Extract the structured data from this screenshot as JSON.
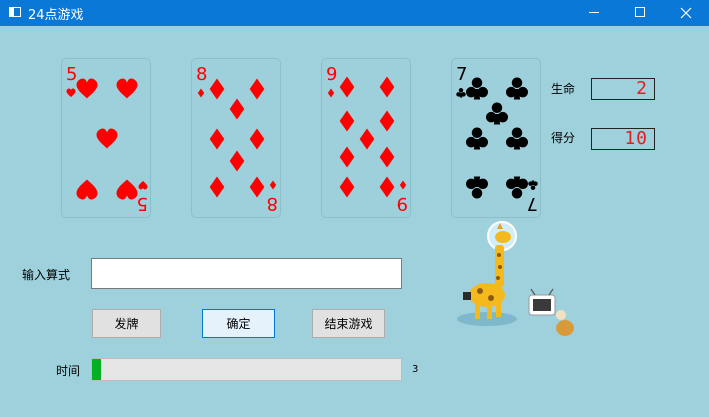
{
  "window": {
    "title": "24点游戏",
    "controls": [
      "minimize-icon",
      "maximize-icon",
      "close-icon"
    ]
  },
  "cards": [
    {
      "rank": "5",
      "suit": "hearts",
      "color": "#ff0000"
    },
    {
      "rank": "8",
      "suit": "diamonds",
      "color": "#ff0000"
    },
    {
      "rank": "9",
      "suit": "diamonds",
      "color": "#ff0000"
    },
    {
      "rank": "7",
      "suit": "clubs",
      "color": "#000000"
    }
  ],
  "stats": {
    "lives_label": "生命",
    "lives_value": "2",
    "score_label": "得分",
    "score_value": "10"
  },
  "formula": {
    "label": "输入算式",
    "value": "",
    "placeholder": ""
  },
  "buttons": {
    "deal": "发牌",
    "confirm": "确定",
    "end": "结束游戏"
  },
  "timer": {
    "label": "时间",
    "value": "3",
    "progress_fraction": 0.03,
    "fill_color": "#06b025"
  },
  "colors": {
    "titlebar": "#0a78d7",
    "background": "#9fd1dd",
    "lcd_digits": "#e02020"
  }
}
